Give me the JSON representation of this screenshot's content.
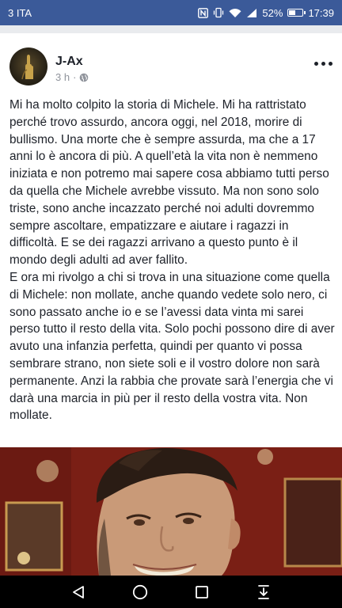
{
  "status_bar": {
    "carrier": "3 ITA",
    "battery_percent": "52%",
    "battery_level": 0.52,
    "time": "17:39",
    "icons": [
      "nfc-icon",
      "vibrate-icon",
      "wifi-icon",
      "signal-icon",
      "battery-icon"
    ]
  },
  "post": {
    "author": "J-Ax",
    "timestamp": "3 h",
    "separator": "·",
    "privacy_icon": "globe-icon",
    "paragraphs": [
      "Mi ha molto colpito la storia di Michele. Mi ha rattristato perché trovo assurdo, ancora oggi, nel 2018, morire di bullismo. Una morte che è sempre assurda, ma che a 17 anni lo è ancora di più. A quell’età la vita non è nemmeno iniziata e non potremo mai sapere cosa abbiamo tutti perso da quella che Michele avrebbe vissuto. Ma non sono solo triste, sono anche incazzato perché noi adulti dovremmo sempre ascoltare, empatizzare e aiutare i ragazzi in difficoltà. E se dei ragazzi arrivano a questo punto è il mondo degli adulti ad aver fallito.",
      "E ora mi rivolgo a chi si trova in una situazione come quella di Michele: non mollate, anche quando vedete solo nero, ci sono passato anche io e se l’avessi data vinta mi sarei perso tutto il resto della vita. Solo pochi possono dire di aver avuto una infanzia perfetta, quindi per quanto vi possa sembrare strano, non siete soli e il vostro dolore non sarà permanente. Anzi la rabbia che provate sarà l’energia che vi darà una marcia in più per il resto della vostra vita. Non mollate."
    ]
  },
  "nav_bar": {
    "buttons": [
      "back-icon",
      "home-icon",
      "recents-icon",
      "notification-drawer-icon"
    ]
  }
}
